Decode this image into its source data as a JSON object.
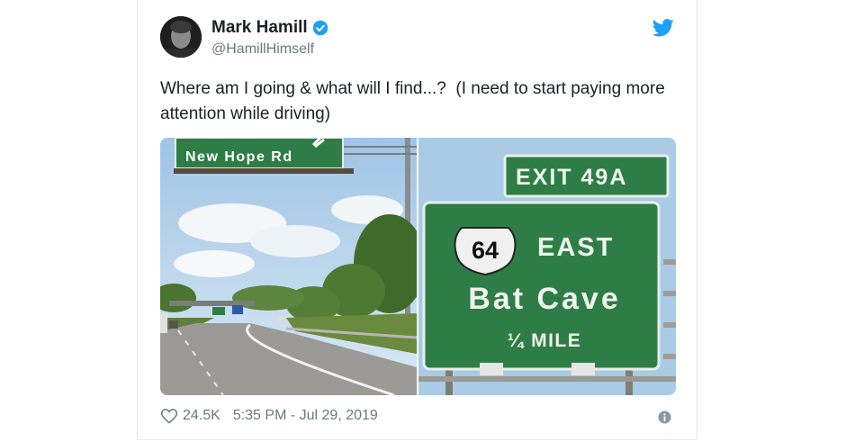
{
  "tweet": {
    "author_name": "Mark Hamill",
    "author_handle": "@HamillHimself",
    "text": "Where am I going & what will I find...?  (I need to start paying more attention while driving)",
    "likes": "24.5K",
    "timestamp": "5:35 PM - Jul 29, 2019"
  },
  "photo_left": {
    "sign_text": "New Hope Rd"
  },
  "photo_right": {
    "exit_text": "EXIT 49A",
    "route_number": "64",
    "direction": "EAST",
    "destination": "Bat Cave",
    "distance": "¼ MILE"
  },
  "icons": {
    "verified": "verified-badge-icon",
    "brand": "twitter-bird-icon",
    "like": "heart-icon",
    "info": "info-icon"
  },
  "colors": {
    "accent": "#1da1f2",
    "sign_green": "#2f7d46",
    "muted_text": "#697882"
  }
}
